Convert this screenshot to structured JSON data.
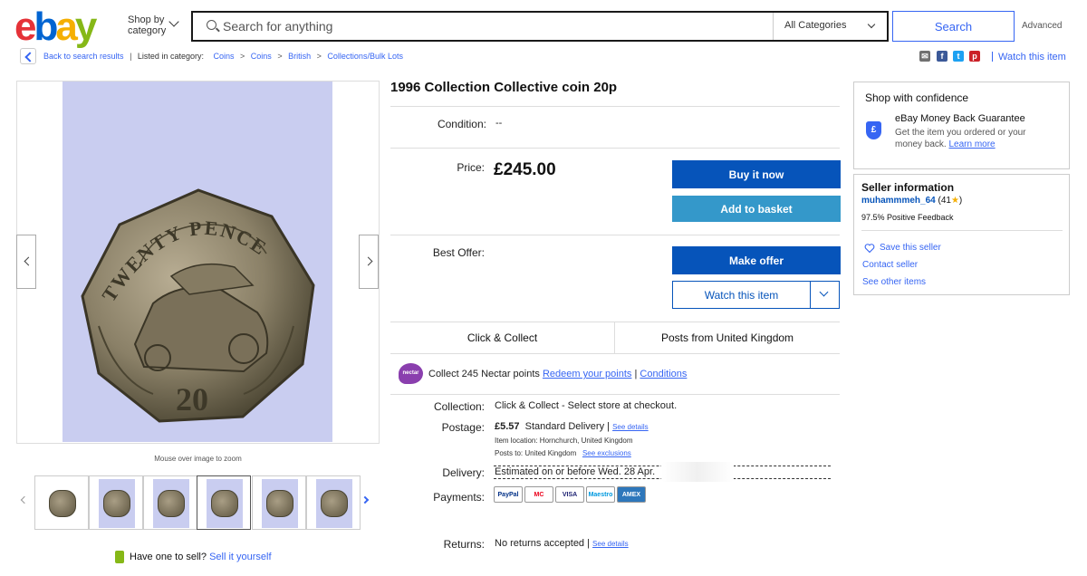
{
  "header": {
    "logo_letters": [
      "e",
      "b",
      "a",
      "y"
    ],
    "shop_by": "Shop by category",
    "search_placeholder": "Search for anything",
    "category": "All Categories",
    "search_button": "Search",
    "advanced": "Advanced"
  },
  "breadcrumb": {
    "back": "Back to search results",
    "listed_in": "Listed in category:",
    "items": [
      "Coins",
      "Coins",
      "British",
      "Collections/Bulk Lots"
    ],
    "watch": "Watch this item"
  },
  "share_icons": [
    {
      "name": "email-icon",
      "glyph": "✉",
      "color": "#707070"
    },
    {
      "name": "facebook-icon",
      "glyph": "f",
      "color": "#3b5998"
    },
    {
      "name": "twitter-icon",
      "glyph": "t",
      "color": "#1da1f2"
    },
    {
      "name": "pinterest-icon",
      "glyph": "p",
      "color": "#cb2027"
    }
  ],
  "gallery": {
    "coin_top_text": "TWENTY PENCE",
    "coin_value": "20",
    "zoom_hint": "Mouse over image to zoom",
    "thumbnail_count": 6,
    "active_thumbnail": 4,
    "sell_question": "Have one to sell?",
    "sell_link": "Sell it yourself"
  },
  "item": {
    "title": "1996 Collection Collective coin 20p",
    "condition_label": "Condition:",
    "condition_value": "--",
    "price_label": "Price:",
    "price": "£245.00",
    "buy_now": "Buy it now",
    "add_basket": "Add to basket",
    "best_offer_label": "Best Offer:",
    "make_offer": "Make offer",
    "watch": "Watch this item",
    "click_collect": "Click & Collect",
    "posts_from": "Posts from United Kingdom",
    "nectar_icon": "nectar",
    "nectar_text": "Collect 245 Nectar points",
    "nectar_redeem": "Redeem your points",
    "nectar_conditions": "Conditions",
    "collection_label": "Collection:",
    "collection_value": "Click & Collect - Select store at checkout.",
    "postage_label": "Postage:",
    "postage_price": "£5.57",
    "postage_type": "Standard Delivery",
    "see_details": "See details",
    "item_location": "Item location:  Hornchurch, United Kingdom",
    "posts_to": "Posts to:  United Kingdom",
    "see_exclusions": "See exclusions",
    "delivery_label": "Delivery:",
    "delivery_value": "Estimated on or before Wed. 28 Apr.",
    "payments_label": "Payments:",
    "payment_methods": [
      {
        "name": "PayPal",
        "color": "#003087"
      },
      {
        "name": "MC",
        "color": "#eb001b"
      },
      {
        "name": "VISA",
        "color": "#1a1f71"
      },
      {
        "name": "Maestro",
        "color": "#0099df"
      },
      {
        "name": "AMEX",
        "color": "#2e77bb"
      }
    ],
    "returns_label": "Returns:",
    "returns_value": "No returns accepted",
    "returns_details": "See details"
  },
  "confidence": {
    "title": "Shop with confidence",
    "guarantee_title": "eBay Money Back Guarantee",
    "guarantee_text": "Get the item you ordered or your money back.",
    "learn_more": "Learn more"
  },
  "seller": {
    "title": "Seller information",
    "name": "muhammmeh_64",
    "score": "(41",
    "score_end": ")",
    "star": "★",
    "feedback": "97.5% Positive Feedback",
    "save": "Save this seller",
    "contact": "Contact seller",
    "other_items": "See other items"
  }
}
